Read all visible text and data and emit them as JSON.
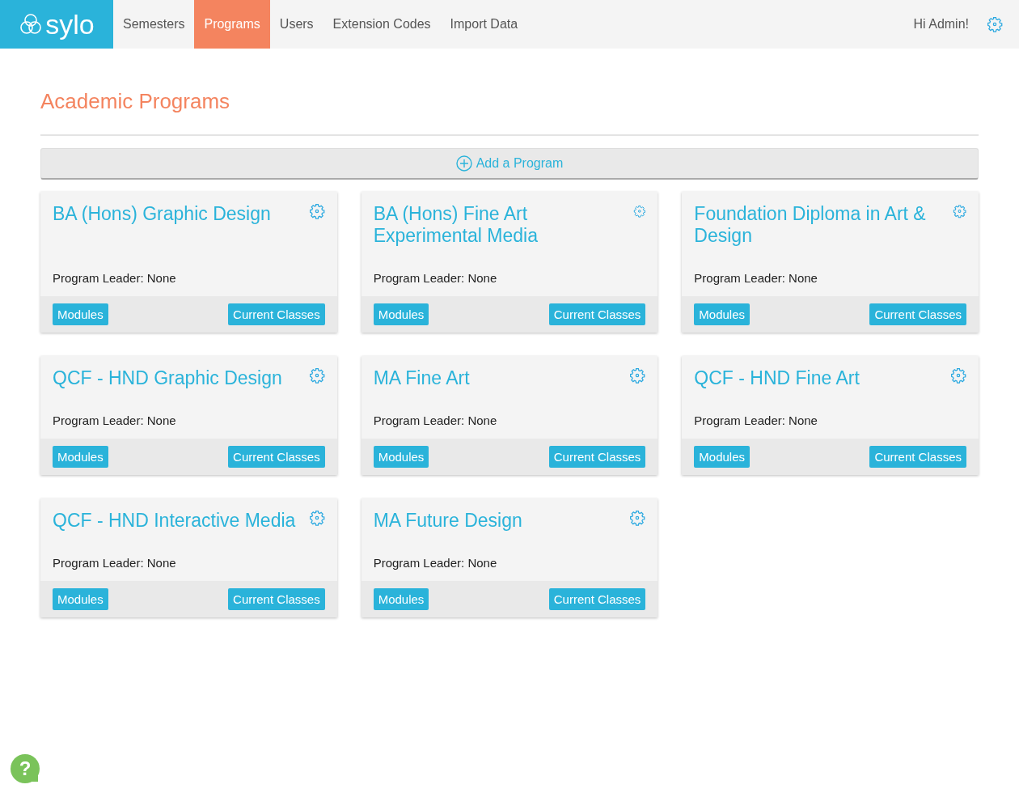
{
  "header": {
    "logo": "sylo",
    "nav": [
      {
        "label": "Semesters",
        "selected": false
      },
      {
        "label": "Programs",
        "selected": true
      },
      {
        "label": "Users",
        "selected": false
      },
      {
        "label": "Extension Codes",
        "selected": false
      },
      {
        "label": "Import Data",
        "selected": false
      }
    ],
    "greeting": "Hi Admin!"
  },
  "page_title": "Academic Programs",
  "add_button": "Add a Program",
  "programs": [
    {
      "title": "BA (Hons) Graphic Design",
      "leader": "Program Leader: None",
      "buttons": [
        "Modules",
        "Current Classes"
      ]
    },
    {
      "title": "BA (Hons) Fine Art Experimental Media",
      "leader": "Program Leader: None",
      "buttons": [
        "Modules",
        "Current Classes"
      ]
    },
    {
      "title": "Foundation Diploma in Art & Design",
      "leader": "Program Leader: None",
      "buttons": [
        "Modules",
        "Current Classes"
      ]
    },
    {
      "title": "QCF - HND Graphic Design",
      "leader": "Program Leader: None",
      "buttons": [
        "Modules",
        "Current Classes"
      ]
    },
    {
      "title": "MA Fine Art",
      "leader": "Program Leader: None",
      "buttons": [
        "Modules",
        "Current Classes"
      ]
    },
    {
      "title": "QCF - HND Fine Art",
      "leader": "Program Leader: None",
      "buttons": [
        "Modules",
        "Current Classes"
      ]
    },
    {
      "title": "QCF - HND Interactive Media",
      "leader": "Program Leader: None",
      "buttons": [
        "Modules",
        "Current Classes"
      ]
    },
    {
      "title": "MA Future Design",
      "leader": "Program Leader: None",
      "buttons": [
        "Modules",
        "Current Classes"
      ]
    }
  ],
  "help": "?"
}
